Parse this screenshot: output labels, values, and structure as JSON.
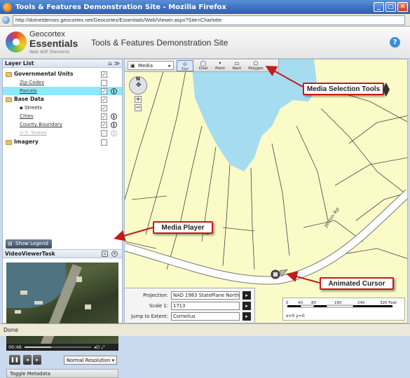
{
  "window": {
    "title": "Tools & Features Demonstration Site - Mozilla Firefox"
  },
  "address_bar": {
    "url": "http://dotnetdemos.geocortex.net/Geocortex/Essentials/Web/Viewer.aspx?Site=Charlotte"
  },
  "header": {
    "logo_line1": "Geocortex",
    "logo_line2": "Essentials",
    "logo_line3": "Web ADF Elements",
    "site_title": "Tools & Features Demonstration Site",
    "help_label": "?"
  },
  "layer_list": {
    "title": "Layer List",
    "groups": [
      {
        "label": "Governmental Units",
        "layers": [
          {
            "label": "Zip Codes"
          },
          {
            "label": "Parcels"
          }
        ]
      },
      {
        "label": "Base Data",
        "layers": [
          {
            "label": "Streets"
          },
          {
            "label": "Cities"
          },
          {
            "label": "County Boundary"
          },
          {
            "label": "U.S. States"
          }
        ]
      },
      {
        "label": "Imagery",
        "layers": []
      }
    ],
    "show_legend_label": "Show Legend"
  },
  "video_task": {
    "title": "VideoViewerTask",
    "current_time": "00:46",
    "progress_percent": 40,
    "resolution_option": "Normal Resolution",
    "toggle_metadata_label": "Toggle Metadata"
  },
  "map_toolbar": {
    "media_label": "Media",
    "tools": [
      {
        "label": "Cur"
      },
      {
        "label": "Oval"
      },
      {
        "label": "Point"
      },
      {
        "label": "Rect"
      },
      {
        "label": "Polygon"
      }
    ]
  },
  "map": {
    "nav_n": "N",
    "zoom_in": "+",
    "zoom_out": "−",
    "road_label": "Jetton Rd",
    "projection_label": "Projection:",
    "projection_value": "NAD 1983 StatePlane North",
    "scale_label": "Scale 1:",
    "scale_value": "1713",
    "jump_label": "Jump to Extent:",
    "jump_value": "Cornelius",
    "scale_ticks": [
      "0",
      "40",
      "80",
      "160",
      "240",
      "320 Feet"
    ],
    "coords": "x=0 y=0"
  },
  "callouts": {
    "media_selection": "Media Selection Tools",
    "media_player": "Media Player",
    "animated_cursor": "Animated Cursor"
  },
  "status": {
    "text": "Done"
  },
  "colors": {
    "water": "#a6dcf0",
    "land": "#fbfbc8",
    "callout_border": "#c41b1b",
    "selected_row": "#8ce9ff"
  }
}
